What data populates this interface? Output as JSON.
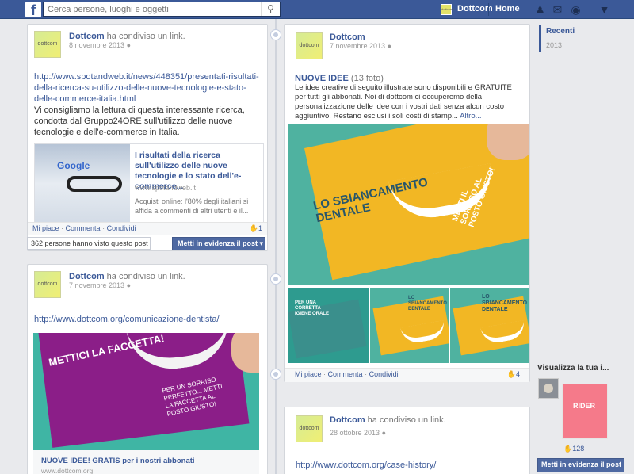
{
  "topbar": {
    "logo": "f",
    "search_placeholder": "Cerca persone, luoghi e oggetti",
    "search_icon": "search-icon",
    "page_avatar_label": "dottcom",
    "page_name": "Dottcom",
    "home_label": "Home",
    "icons": [
      "friends-icon",
      "messages-icon",
      "notifications-icon",
      "settings-icon"
    ],
    "bar_color": "#3b5998"
  },
  "posts": {
    "p1": {
      "avatar_label": "dottcom",
      "name": "Dottcom",
      "action": "ha condiviso un link.",
      "date": "8 novembre 2013",
      "url": "http://www.spotandweb.it/news/448351/presentati-risultati-della-ricerca-su-utilizzo-delle-nuove-tecnologie-e-stato-delle-commerce-italia.html",
      "text": "Vi consigliamo la lettura di questa interessante ricerca, condotta dal Gruppo24ORE sull'utilizzo delle nuove tecnologie e dell'e-commerce in Italia.",
      "preview": {
        "image_text": "Google",
        "title": "I risultati della ricerca sull'utilizzo delle nuove tecnologie e lo stato dell'e-commerce...",
        "domain": "www.spotandweb.it",
        "desc": "Acquisti online: l'80% degli italiani si affida a commenti di altri utenti e il..."
      },
      "actions": {
        "like": "Mi piace",
        "comment": "Commenta",
        "share": "Condividi",
        "sep": "·"
      },
      "likes": "1",
      "seen": "362 persone hanno visto questo post",
      "highlight": "Metti in evidenza il post"
    },
    "p2": {
      "avatar_label": "dottcom",
      "name": "Dottcom",
      "action": "ha condiviso un link.",
      "date": "7 novembre 2013",
      "url": "http://www.dottcom.org/comunicazione-dentista/",
      "image": {
        "headline": "METTICI LA FACCETTA!",
        "side": "PER UN SORRISO PERFETTO... METTI LA FACCETTA AL POSTO GIUSTO!"
      },
      "caption_title": "NUOVE IDEE! GRATIS per i nostri abbonati",
      "caption_domain": "www.dottcom.org"
    },
    "p3": {
      "avatar_label": "dottcom",
      "name": "Dottcom",
      "date": "7 novembre 2013",
      "album_title": "NUOVE IDEE",
      "album_count": "(13 foto)",
      "desc": "Le idee creative di seguito illustrate sono disponibili e GRATUITE per tutti gli abbonati. Noi di dottcom ci occuperemo della personalizzazione delle idee con i vostri dati senza alcun costo aggiuntivo. Restano esclusi i soli costi di stamp...",
      "more": "Altro...",
      "big_photo": {
        "headline": "LO SBIANCAMENTO DENTALE",
        "side": "METTI IL SORRISO AL POSTO GIUSTO!"
      },
      "thumbs": [
        {
          "text": "PER UNA CORRETTA IGIENE ORALE"
        },
        {
          "text": "LO SBIANCAMENTO DENTALE"
        },
        {
          "text": "LO SBIANCAMENTO DENTALE"
        }
      ],
      "actions": {
        "like": "Mi piace",
        "comment": "Commenta",
        "share": "Condividi",
        "sep": "·"
      },
      "likes": "4"
    },
    "p4": {
      "avatar_label": "dottcom",
      "name": "Dottcom",
      "action": "ha condiviso un link.",
      "date": "28 ottobre 2013",
      "url": "http://www.dottcom.org/case-history/"
    }
  },
  "sidebar": {
    "recenti": "Recenti",
    "year": "2013",
    "viz_title": "Visualizza la tua i...",
    "viz_image_text": "RIDER",
    "viz_likes": "128",
    "highlight": "Metti in evidenza il post"
  }
}
